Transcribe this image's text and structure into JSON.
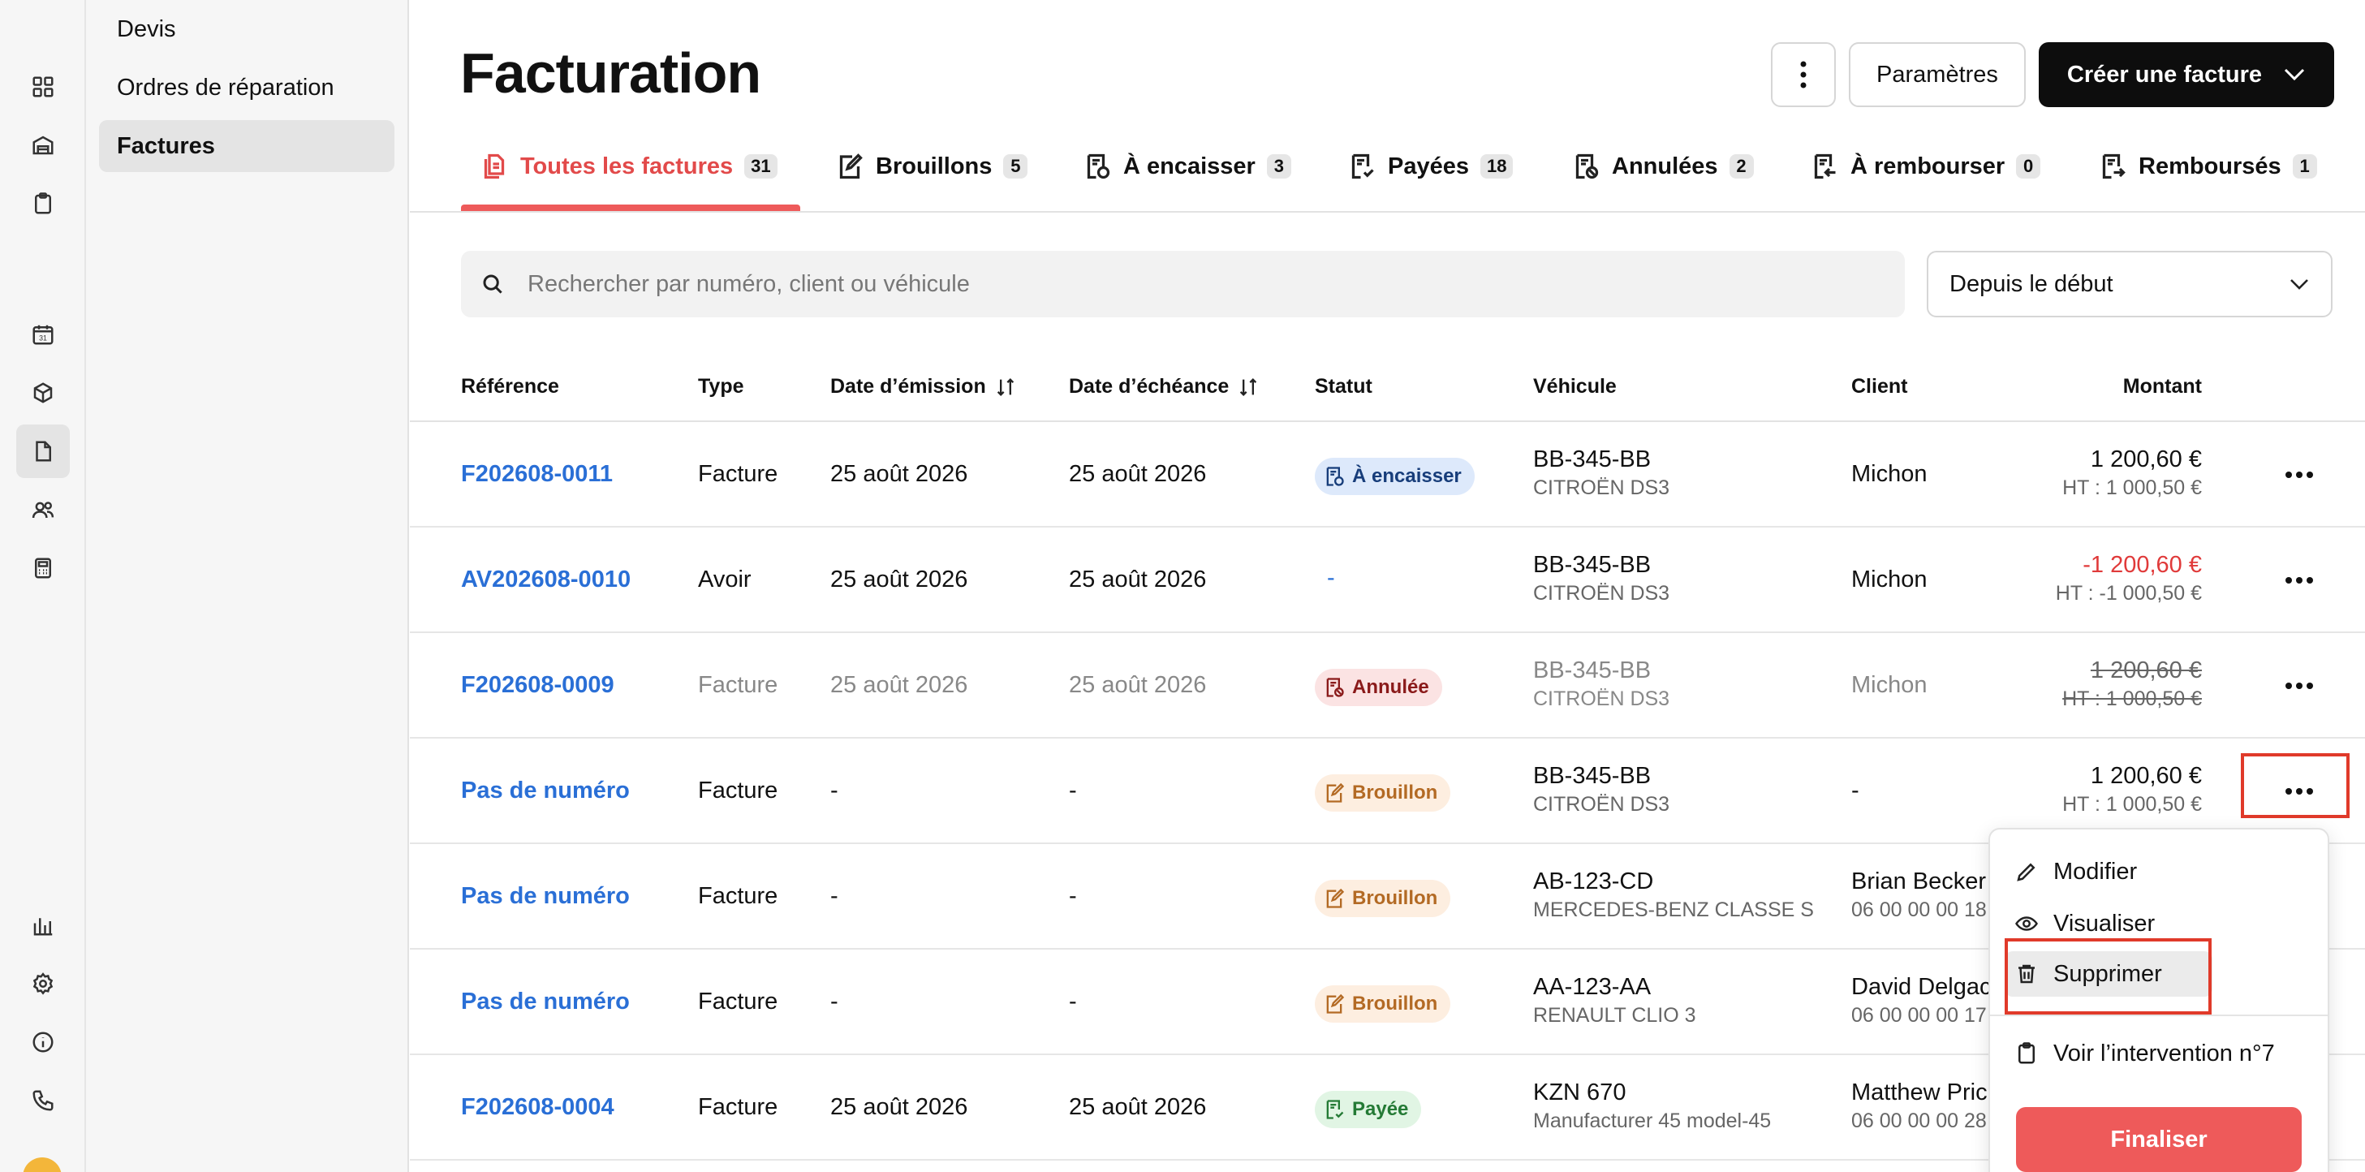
{
  "subnav": {
    "items": [
      {
        "label": "Devis"
      },
      {
        "label": "Ordres de réparation"
      },
      {
        "label": "Factures",
        "active": true
      }
    ]
  },
  "rail": {
    "icons": [
      "dashboard-icon",
      "garage-icon",
      "clipboard-icon",
      "calendar-icon",
      "box-icon",
      "document-icon",
      "users-icon",
      "calculator-icon",
      "chart-icon",
      "settings-icon",
      "info-icon",
      "phone-icon"
    ],
    "calendar_day": "31"
  },
  "header": {
    "title": "Facturation",
    "params_label": "Paramètres",
    "create_label": "Créer une facture"
  },
  "tabs": [
    {
      "label": "Toutes les factures",
      "count": "31",
      "active": true
    },
    {
      "label": "Brouillons",
      "count": "5"
    },
    {
      "label": "À encaisser",
      "count": "3"
    },
    {
      "label": "Payées",
      "count": "18"
    },
    {
      "label": "Annulées",
      "count": "2"
    },
    {
      "label": "À rembourser",
      "count": "0"
    },
    {
      "label": "Remboursés",
      "count": "1"
    }
  ],
  "search": {
    "placeholder": "Rechercher par numéro, client ou véhicule"
  },
  "period": {
    "selected": "Depuis le début"
  },
  "table": {
    "columns": {
      "reference": "Référence",
      "type": "Type",
      "issue_date": "Date d’émission",
      "due_date": "Date d’échéance",
      "status": "Statut",
      "vehicle": "Véhicule",
      "client": "Client",
      "amount": "Montant"
    },
    "rows": [
      {
        "reference": "F202608-0011",
        "type": "Facture",
        "issue_date": "25 août 2026",
        "due_date": "25 août 2026",
        "status": "À encaisser",
        "plate": "BB-345-BB",
        "model": "CITROËN DS3",
        "client": "Michon",
        "client_phone": "",
        "amount": "1 200,60 €",
        "ht": "HT : 1 000,50 €"
      },
      {
        "reference": "AV202608-0010",
        "type": "Avoir",
        "issue_date": "25 août 2026",
        "due_date": "25 août 2026",
        "status": "-",
        "plate": "BB-345-BB",
        "model": "CITROËN DS3",
        "client": "Michon",
        "client_phone": "",
        "amount": "-1 200,60 €",
        "ht": "HT : -1 000,50 €"
      },
      {
        "reference": "F202608-0009",
        "type": "Facture",
        "issue_date": "25 août 2026",
        "due_date": "25 août 2026",
        "status": "Annulée",
        "plate": "BB-345-BB",
        "model": "CITROËN DS3",
        "client": "Michon",
        "client_phone": "",
        "amount": "1 200,60 €",
        "ht": "HT : 1 000,50 €"
      },
      {
        "reference": "Pas de numéro",
        "type": "Facture",
        "issue_date": "-",
        "due_date": "-",
        "status": "Brouillon",
        "plate": "BB-345-BB",
        "model": "CITROËN DS3",
        "client": "-",
        "client_phone": "",
        "amount": "1 200,60 €",
        "ht": "HT : 1 000,50 €"
      },
      {
        "reference": "Pas de numéro",
        "type": "Facture",
        "issue_date": "-",
        "due_date": "-",
        "status": "Brouillon",
        "plate": "AB-123-CD",
        "model": "MERCEDES-BENZ CLASSE S",
        "client": "Brian Becker",
        "client_phone": "06 00 00 00 18",
        "amount": "",
        "ht": ""
      },
      {
        "reference": "Pas de numéro",
        "type": "Facture",
        "issue_date": "-",
        "due_date": "-",
        "status": "Brouillon",
        "plate": "AA-123-AA",
        "model": "RENAULT CLIO 3",
        "client": "David Delgac",
        "client_phone": "06 00 00 00 17",
        "amount": "",
        "ht": ""
      },
      {
        "reference": "F202608-0004",
        "type": "Facture",
        "issue_date": "25 août 2026",
        "due_date": "25 août 2026",
        "status": "Payée",
        "plate": "KZN 670",
        "model": "Manufacturer 45 model-45",
        "client": "Matthew Pric",
        "client_phone": "06 00 00 00 28",
        "amount": "",
        "ht": ""
      }
    ]
  },
  "row_menu": {
    "edit": "Modifier",
    "view": "Visualiser",
    "delete": "Supprimer",
    "intervention": "Voir l’intervention n°7",
    "finalise": "Finaliser"
  },
  "colors": {
    "accent": "#ee5a5a",
    "link": "#2a6fd6",
    "highlight": "#e03a2a"
  }
}
